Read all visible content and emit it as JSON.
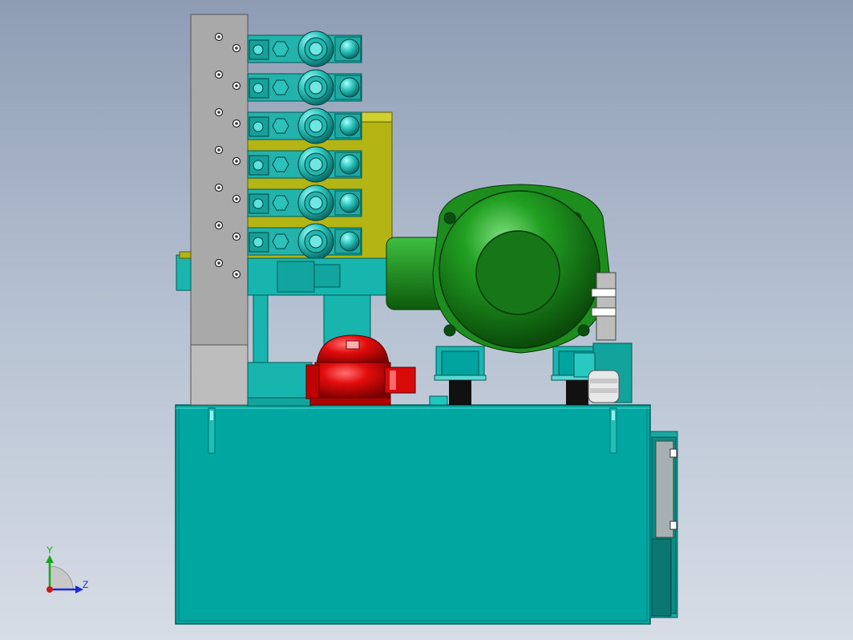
{
  "viewport": {
    "model": "hydraulic-power-unit",
    "view": "side",
    "background_top": "#8e9db4",
    "background_bottom": "#d7dde6"
  },
  "colors": {
    "tank": "#00a6a0",
    "tank_edge": "#006e6a",
    "valve": "#27b3ad",
    "valve_light": "#5ee0dc",
    "manifold": "#a8a8a8",
    "manifold_block": "#b0b018",
    "motor": "#1a8a1a",
    "motor_dark": "#0b4d0b",
    "filter": "#e00a0a",
    "foot": "#111111"
  },
  "valve_stack": {
    "count": 6
  },
  "triad": {
    "x_label": "",
    "y_label": "Y",
    "z_label": "Z",
    "y_color": "#1aa81a",
    "z_color": "#1a2ad8",
    "origin_color": "#d01818"
  }
}
